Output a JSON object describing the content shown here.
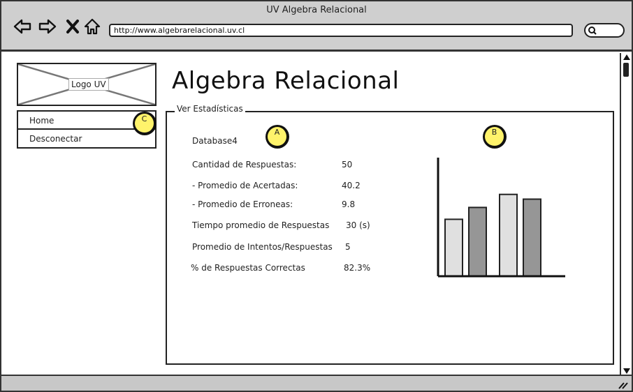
{
  "window": {
    "title": "UV Algebra Relacional"
  },
  "browser": {
    "url": "http://www.algebrarelacional.uv.cl",
    "nav_icons": [
      "back-arrow-icon",
      "forward-arrow-icon",
      "close-x-icon",
      "home-icon"
    ],
    "search_icon": "search-icon"
  },
  "logo": {
    "label": "Logo UV"
  },
  "sidenav": {
    "items": [
      {
        "label": "Home"
      },
      {
        "label": "Desconectar"
      }
    ]
  },
  "page": {
    "title": "Algebra Relacional"
  },
  "stats": {
    "legend": "Ver Estadísticas",
    "database": "Database4",
    "rows": [
      {
        "label": "Cantidad de Respuestas:",
        "value": "50"
      },
      {
        "label": "- Promedio de Acertadas:",
        "value": "40.2"
      },
      {
        "label": "- Promedio de Erroneas:",
        "value": "9.8"
      },
      {
        "label": "Tiempo promedio de Respuestas",
        "value": "30 (s)"
      },
      {
        "label": "Promedio de Intentos/Respuestas",
        "value": "5"
      },
      {
        "label": "% de Respuestas Correctas",
        "value": "82.3%"
      }
    ]
  },
  "callouts": {
    "a": "A",
    "b": "B",
    "c": "C",
    "color": "#fff36b"
  },
  "chart_data": {
    "type": "bar",
    "categories": [
      "",
      ""
    ],
    "series": [
      {
        "values": [
          48,
          69
        ]
      },
      {
        "values": [
          58,
          65
        ]
      }
    ],
    "colors": [
      "#e0e0e0",
      "#969696"
    ],
    "ylim": [
      0,
      100
    ],
    "grid": false,
    "title": "",
    "xlabel": "",
    "ylabel": ""
  },
  "colors": {
    "chrome": "#cfcfcf",
    "status": "#c8c8c8",
    "outline": "#222222"
  }
}
